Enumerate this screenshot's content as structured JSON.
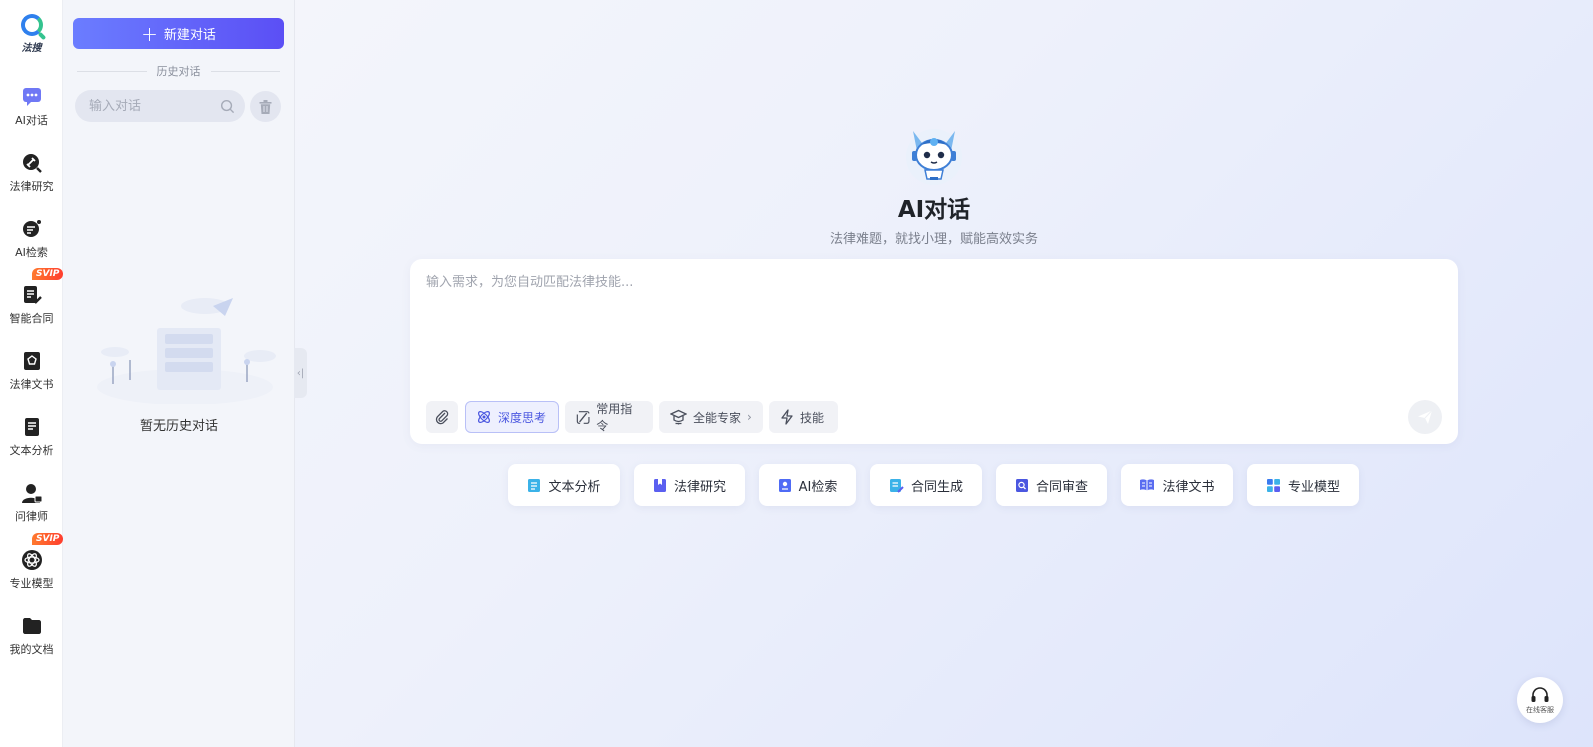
{
  "rail": {
    "logo_text": "法搜",
    "items": [
      {
        "label": "AI对话",
        "icon": "chat-bubble-icon"
      },
      {
        "label": "法律研究",
        "icon": "gavel-search-icon"
      },
      {
        "label": "AI检索",
        "icon": "ai-search-icon"
      },
      {
        "label": "智能合同",
        "icon": "contract-edit-icon",
        "badge": "SVIP"
      },
      {
        "label": "法律文书",
        "icon": "legal-document-icon"
      },
      {
        "label": "文本分析",
        "icon": "text-analysis-icon"
      },
      {
        "label": "问律师",
        "icon": "lawyer-icon"
      },
      {
        "label": "专业模型",
        "icon": "model-atom-icon",
        "badge": "SVIP"
      },
      {
        "label": "我的文档",
        "icon": "folder-icon"
      }
    ]
  },
  "panel": {
    "new_chat_label": "新建对话",
    "history_title": "历史对话",
    "search_placeholder": "输入对话",
    "empty_text": "暂无历史对话"
  },
  "main": {
    "title": "AI对话",
    "subtitle": "法律难题，就找小理，赋能高效实务",
    "input_placeholder": "输入需求，为您自动匹配法律技能...",
    "tools": {
      "deep_think": "深度思考",
      "common_cmd": "常用指令",
      "expert": "全能专家",
      "skills": "技能"
    },
    "chips": [
      {
        "label": "文本分析",
        "icon": "text-analysis-icon",
        "color": "#3bb2e8"
      },
      {
        "label": "法律研究",
        "icon": "book-icon",
        "color": "#5b5ff0"
      },
      {
        "label": "AI检索",
        "icon": "ai-doc-icon",
        "color": "#4f6bf5"
      },
      {
        "label": "合同生成",
        "icon": "contract-icon",
        "color": "#3bb2e8"
      },
      {
        "label": "合同审查",
        "icon": "review-icon",
        "color": "#4b57e0"
      },
      {
        "label": "法律文书",
        "icon": "open-book-icon",
        "color": "#5a6cf0"
      },
      {
        "label": "专业模型",
        "icon": "grid-icon",
        "color": "#3a7bf0"
      }
    ],
    "support_label": "在线客服"
  },
  "colors": {
    "accent": "#5b5ff0",
    "svip_badge": "#ff5a2e"
  }
}
